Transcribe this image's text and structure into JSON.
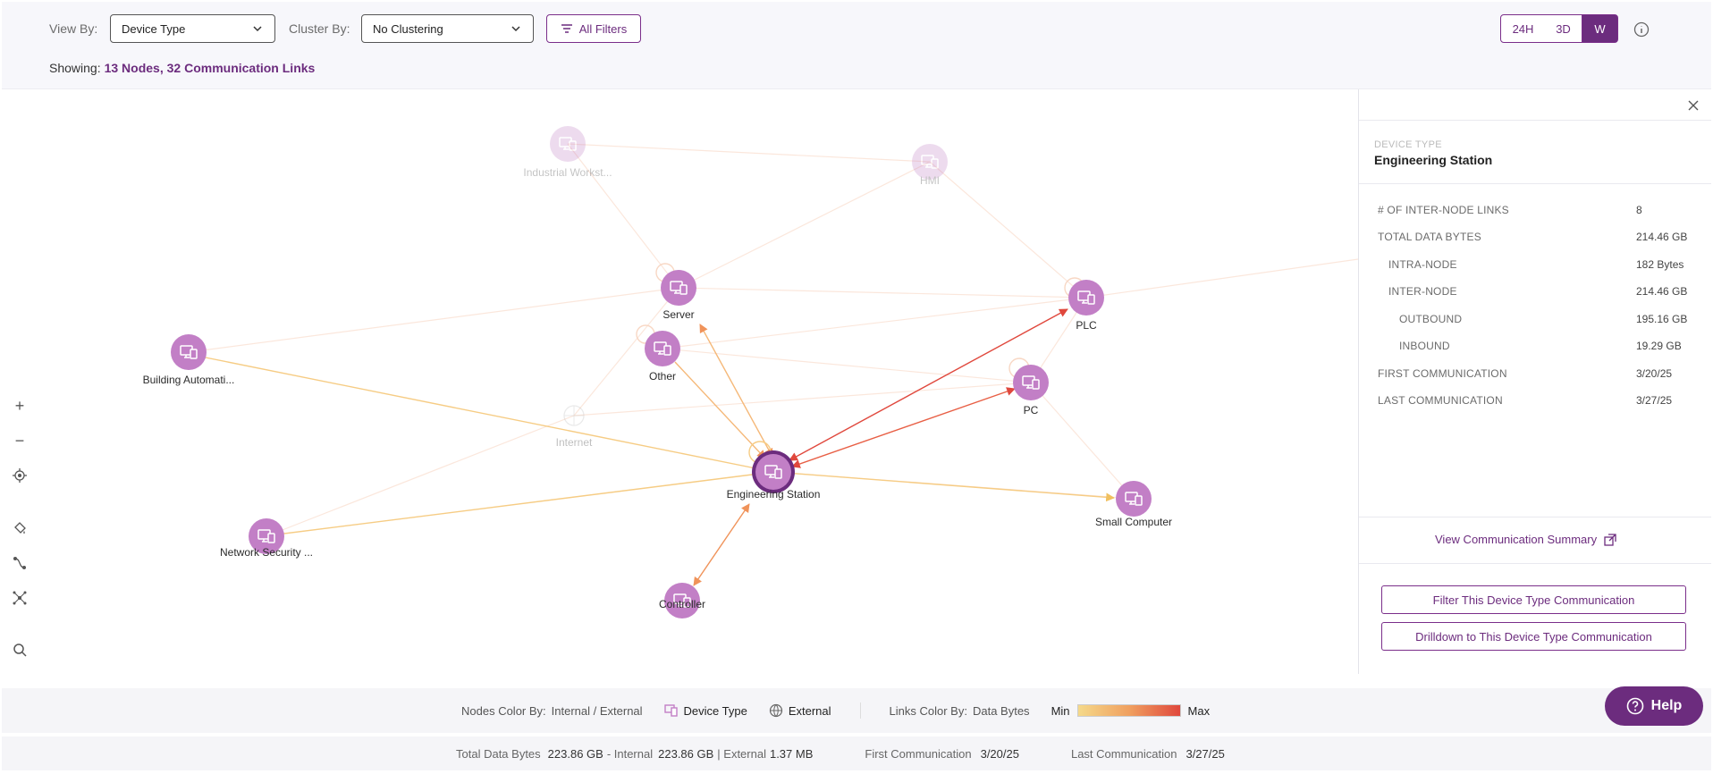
{
  "toolbar": {
    "view_by_label": "View By:",
    "view_by_value": "Device Type",
    "cluster_by_label": "Cluster By:",
    "cluster_by_value": "No Clustering",
    "filters_label": "All Filters",
    "time_ranges": [
      "24H",
      "3D",
      "W"
    ],
    "active_time_range": "W",
    "showing_label": "Showing:",
    "showing_value": "13 Nodes, 32 Communication Links"
  },
  "graph": {
    "nodes": [
      {
        "id": "industrial",
        "label": "Industrial Workst...",
        "faded": true,
        "icon": "monitor-icon"
      },
      {
        "id": "hmi",
        "label": "HMI",
        "faded": true,
        "icon": "monitor-icon"
      },
      {
        "id": "server",
        "label": "Server",
        "faded": false,
        "icon": "monitor-icon"
      },
      {
        "id": "plc",
        "label": "PLC",
        "faded": false,
        "icon": "monitor-icon"
      },
      {
        "id": "building",
        "label": "Building Automati...",
        "faded": false,
        "icon": "monitor-icon"
      },
      {
        "id": "other",
        "label": "Other",
        "faded": false,
        "icon": "monitor-icon"
      },
      {
        "id": "pc",
        "label": "PC",
        "faded": false,
        "icon": "monitor-icon"
      },
      {
        "id": "internet",
        "label": "Internet",
        "faded": true,
        "icon": "globe-icon"
      },
      {
        "id": "engineering",
        "label": "Engineering Station",
        "faded": false,
        "selected": true,
        "icon": "monitor-icon"
      },
      {
        "id": "small",
        "label": "Small Computer",
        "faded": false,
        "icon": "monitor-icon"
      },
      {
        "id": "network",
        "label": "Network Security ...",
        "faded": false,
        "icon": "monitor-icon"
      },
      {
        "id": "controller",
        "label": "Controller",
        "faded": false,
        "icon": "monitor-icon"
      }
    ],
    "tools": [
      "zoom-in-icon",
      "zoom-out-icon",
      "recenter-icon",
      "paint-bucket-icon",
      "route-icon",
      "network-icon",
      "search-icon"
    ],
    "colors": {
      "node": "#c27fc6",
      "node_selected_ring": "#6c2c7e",
      "link_min": "#f5d98a",
      "link_max": "#e0483d"
    }
  },
  "panel": {
    "device_type_label": "DEVICE TYPE",
    "device_type_value": "Engineering Station",
    "stats": [
      {
        "label": "# OF INTER-NODE LINKS",
        "value": "8",
        "indent": 0
      },
      {
        "label": "TOTAL DATA BYTES",
        "value": "214.46 GB",
        "indent": 0
      },
      {
        "label": "INTRA-NODE",
        "value": "182 Bytes",
        "indent": 1
      },
      {
        "label": "INTER-NODE",
        "value": "214.46 GB",
        "indent": 1
      },
      {
        "label": "OUTBOUND",
        "value": "195.16 GB",
        "indent": 2
      },
      {
        "label": "INBOUND",
        "value": "19.29 GB",
        "indent": 2
      },
      {
        "label": "FIRST COMMUNICATION",
        "value": "3/20/25",
        "indent": 0
      },
      {
        "label": "LAST COMMUNICATION",
        "value": "3/27/25",
        "indent": 0
      }
    ],
    "summary_link": "View Communication Summary",
    "filter_button": "Filter This Device Type Communication",
    "drilldown_button": "Drilldown to This Device Type Communication"
  },
  "legend": {
    "nodes_color_by_label": "Nodes Color By:",
    "nodes_color_by_value": "Internal / External",
    "device_type": "Device Type",
    "external": "External",
    "links_color_by_label": "Links Color By:",
    "links_color_by_value": "Data Bytes",
    "min": "Min",
    "max": "Max"
  },
  "footer": {
    "total_label": "Total Data Bytes",
    "total_value": "223.86 GB",
    "internal_label": "- Internal",
    "internal_value": "223.86 GB",
    "external_label": "| External",
    "external_value": "1.37 MB",
    "first_label": "First Communication",
    "first_value": "3/20/25",
    "last_label": "Last Communication",
    "last_value": "3/27/25"
  },
  "help_label": "Help"
}
